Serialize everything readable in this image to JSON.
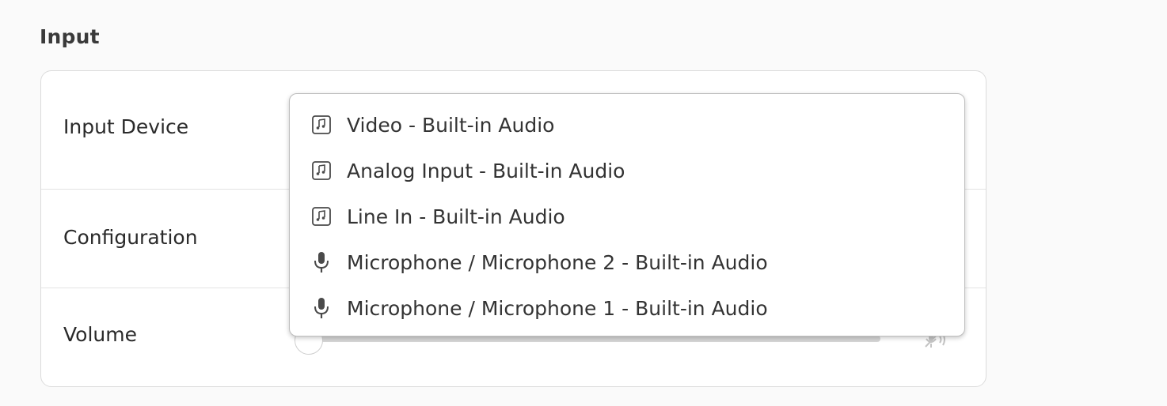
{
  "section": {
    "title": "Input"
  },
  "rows": {
    "input_device_label": "Input Device",
    "configuration_label": "Configuration",
    "volume_label": "Volume"
  },
  "volume": {
    "level": 0.0,
    "muted": true,
    "icon": "microphone-muted-icon"
  },
  "dropdown": {
    "items": [
      {
        "label": "Video - Built-in Audio",
        "icon": "audio-card-icon"
      },
      {
        "label": "Analog Input - Built-in Audio",
        "icon": "audio-card-icon"
      },
      {
        "label": "Line In - Built-in Audio",
        "icon": "audio-card-icon"
      },
      {
        "label": "Microphone / Microphone 2 - Built-in Audio",
        "icon": "microphone-icon"
      },
      {
        "label": "Microphone / Microphone 1 - Built-in Audio",
        "icon": "microphone-icon"
      }
    ]
  },
  "colors": {
    "background": "#fafafa",
    "card": "#ffffff",
    "text": "#333333",
    "border": "#dcdcdc"
  }
}
